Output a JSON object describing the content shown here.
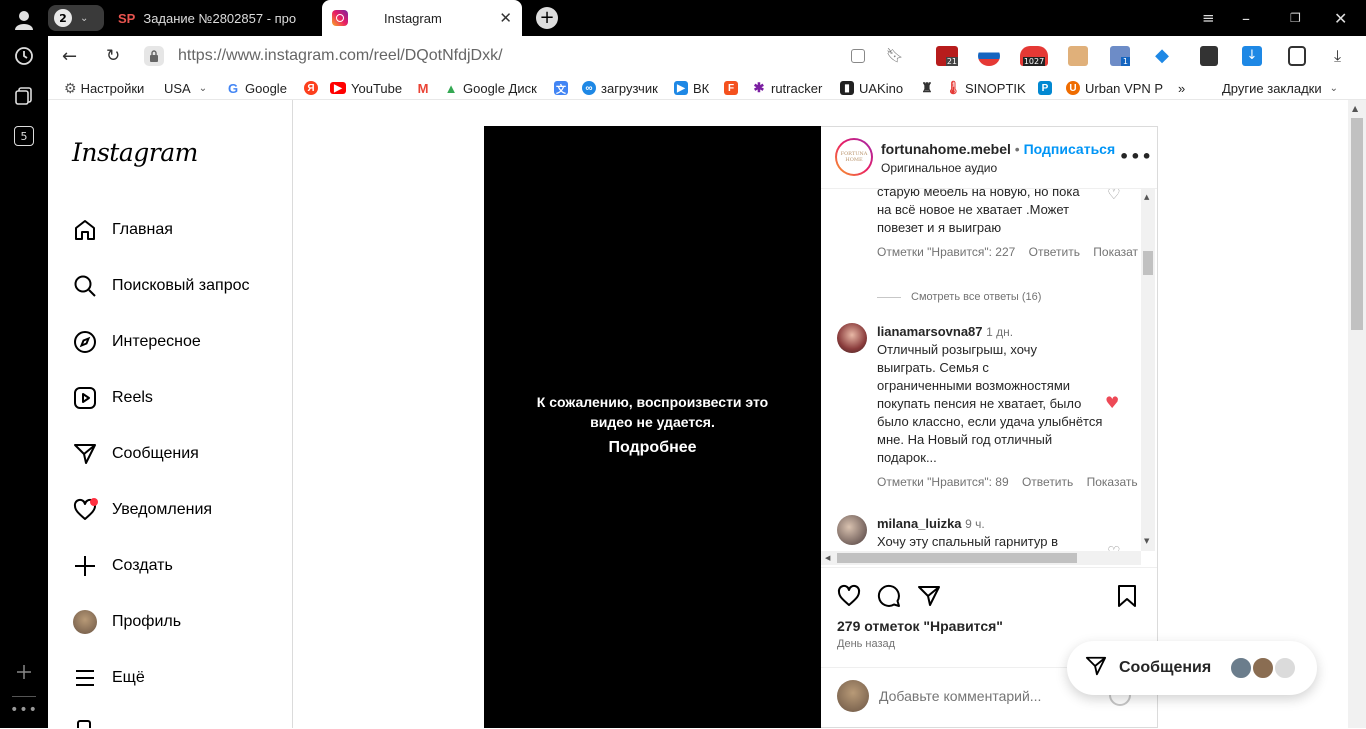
{
  "browser": {
    "rail": {
      "tab_count_badge": "2",
      "notif_badge": "5"
    },
    "tabs": [
      {
        "title": "Задание №2802857 - про",
        "favicon": "SP"
      },
      {
        "title": "Instagram"
      }
    ],
    "url": "https://www.instagram.com/reel/DQotNfdjDxk/",
    "ext_badges": {
      "b1": "21",
      "b2": "1027",
      "b3": "1"
    },
    "bookmarks": [
      {
        "label": "Настройки",
        "icon": "gear-icon"
      },
      {
        "label": "USA",
        "icon": "dropdown"
      },
      {
        "label": "Google",
        "icon": "G"
      },
      {
        "label": "",
        "icon": "Я"
      },
      {
        "label": "YouTube",
        "icon": "youtube"
      },
      {
        "label": "",
        "icon": "M"
      },
      {
        "label": "Google Диск",
        "icon": "drive"
      },
      {
        "label": "",
        "icon": "translate"
      },
      {
        "label": "загрузчик",
        "icon": "loader"
      },
      {
        "label": "ВК",
        "icon": "vk"
      },
      {
        "label": "",
        "icon": "F"
      },
      {
        "label": "rutracker",
        "icon": "rutracker"
      },
      {
        "label": "UAKino",
        "icon": "uakino"
      },
      {
        "label": "",
        "icon": "torch"
      },
      {
        "label": "SINOPTIK",
        "icon": "sinoptik"
      },
      {
        "label": "",
        "icon": "P"
      },
      {
        "label": "Urban VPN P",
        "icon": "urban"
      }
    ],
    "other_bookmarks": "Другие закладки",
    "chevron_more": "»"
  },
  "instagram": {
    "logo": "Instagram",
    "nav": [
      {
        "label": "Главная",
        "icon": "home-icon"
      },
      {
        "label": "Поисковый запрос",
        "icon": "search-icon"
      },
      {
        "label": "Интересное",
        "icon": "compass-icon"
      },
      {
        "label": "Reels",
        "icon": "reels-icon"
      },
      {
        "label": "Сообщения",
        "icon": "messages-icon"
      },
      {
        "label": "Уведомления",
        "icon": "heart-icon"
      },
      {
        "label": "Создать",
        "icon": "plus-icon"
      },
      {
        "label": "Профиль",
        "icon": "avatar"
      },
      {
        "label": "Ещё",
        "icon": "menu-icon"
      }
    ],
    "video": {
      "error_line1": "К сожалению, воспроизвести это",
      "error_line2": "видео не удается.",
      "more_link": "Подробнее"
    },
    "post": {
      "username": "fortunahome.mebel",
      "dot": "•",
      "follow": "Подписаться",
      "audio": "Оригинальное аудио",
      "avatar_text": "FORTUNA HOME"
    },
    "comments": [
      {
        "lines": [
          "старую мебель на новую, но пока",
          "на всё новое не хватает .Может",
          "повезет и я выиграю"
        ],
        "likes": "Отметки \"Нравится\": 227",
        "reply": "Ответить",
        "show": "Показат"
      },
      {
        "view_replies": "Смотреть все ответы (16)"
      },
      {
        "username": "lianamarsovna87",
        "time": "1 дн.",
        "lines": [
          "Отличный розыгрыш, хочу",
          "выиграть. Семья с",
          "ограниченными возможностями",
          "покупать пенсия не хватает, было",
          "было классно, если удача улыбнётся",
          "мне. На Новый год отличный",
          "подарок..."
        ],
        "likes": "Отметки \"Нравится\": 89",
        "reply": "Ответить",
        "show": "Показать"
      },
      {
        "username": "milana_luizka",
        "time": "9 ч.",
        "lines": [
          "Хочу эту спальный гарнитур в"
        ]
      }
    ],
    "likes_count": "279 отметок \"Нравится\"",
    "posted": "День назад",
    "add_comment_placeholder": "Добавьте комментарий...",
    "messages_popup": "Сообщения",
    "colors": {
      "accent": "#0095f6",
      "like": "#ed4956"
    }
  }
}
